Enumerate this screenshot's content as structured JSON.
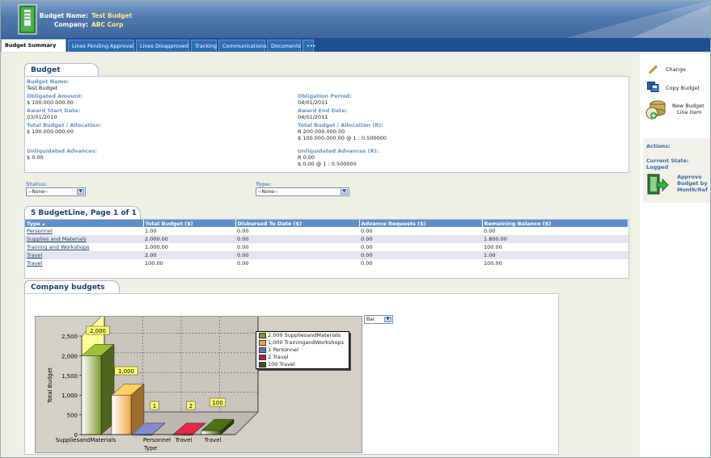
{
  "header": {
    "budget_name_label": "Budget Name:",
    "budget_name": "Test Budget",
    "company_label": "Company:",
    "company": "ABC Corp"
  },
  "tabs": [
    {
      "label": "Budget Summary"
    },
    {
      "label": "Lines Pending Approval"
    },
    {
      "label": "Lines Disapproved"
    },
    {
      "label": "Tracking"
    },
    {
      "label": "Communications"
    },
    {
      "label": "Documents"
    },
    {
      "label": "•••"
    }
  ],
  "budget": {
    "title": "Budget",
    "budget_name_label": "Budget Name:",
    "budget_name": "Test Budget",
    "obligated_label": "Obligated Amount:",
    "obligated": "$ 100.000.000.00",
    "obligation_period_label": "Obligation Period:",
    "obligation_period": "04/01/2011",
    "award_start_label": "Award Start Date:",
    "award_start": "03/01/2010",
    "award_end_label": "Award End Date:",
    "award_end": "04/01/2011",
    "total_label": "Total Budget / Allocation:",
    "total": "$ 100.000.000.00",
    "total_r_label": "Total Budget / Allocation (R):",
    "total_r_1": "R 200.000.000.00",
    "total_r_2": "$ 100.000.000.00 @ 1 : 0.500000",
    "unliq_label": "Unliquidated Advances:",
    "unliq": "$ 0.00",
    "unliq_r_label": "Unliquidated Advances (R):",
    "unliq_r_1": "R 0.00",
    "unliq_r_2": "$ 0.00 @ 1 : 0.500000"
  },
  "filters": {
    "status_label": "Status:",
    "status_value": "--None--",
    "type_label": "Type:",
    "type_value": "--None--"
  },
  "lines": {
    "title": "5 BudgetLine, Page 1 of 1",
    "headers": [
      "Type ▴",
      "Total Budget ($)",
      "Disbursed To Date ($)",
      "Advance Requests ($)",
      "Remaining Balance ($)"
    ],
    "rows": [
      [
        "Personnel",
        "1.00",
        "0.00",
        "0.00",
        "0.00"
      ],
      [
        "Supplies and Materials",
        "2.000.00",
        "0.00",
        "0.00",
        "1.800.00"
      ],
      [
        "Training and Workshops",
        "1.000.00",
        "0.00",
        "0.00",
        "100.00"
      ],
      [
        "Travel",
        "2.00",
        "0.00",
        "0.00",
        "1.00"
      ],
      [
        "Travel",
        "100.00",
        "0.00",
        "0.00",
        "100.00"
      ]
    ]
  },
  "company_budgets": {
    "title": "Company budgets",
    "chart_type_select": "Bar"
  },
  "sidebar": {
    "change": "Change",
    "copy_budget": "Copy Budget",
    "new_line_1": "New Budget",
    "new_line_2": "Line Item",
    "actions_label": "Actions:",
    "current_state": "Current State: Logged",
    "approve_1": "Approve",
    "approve_2": "Budget by",
    "approve_3": "Month/Ref"
  },
  "chart_data": {
    "type": "bar",
    "categories": [
      "SuppliesandMaterials",
      "Personnel",
      "Travel",
      "Travel"
    ],
    "extra_category": "TrainingandWorkshops",
    "series": [
      {
        "name": "2,000  SuppliesandMaterials",
        "value": 2000,
        "color": "#7c9a2e"
      },
      {
        "name": "1,000  TrainingandWorkshops",
        "value": 1000,
        "color": "#f0a64a"
      },
      {
        "name": "1  Personnel",
        "value": 1,
        "color": "#6a70a8"
      },
      {
        "name": "2  Travel",
        "value": 2,
        "color": "#b4203a"
      },
      {
        "name": "100  Travel",
        "value": 100,
        "color": "#3d5a10"
      }
    ],
    "data_labels": [
      "2,000",
      "1,000",
      "1",
      "2",
      "100"
    ],
    "xlabel": "Type",
    "ylabel": "Total Budget",
    "yticks": [
      "0",
      "500",
      "1,000",
      "1,500",
      "2,000",
      "2,500"
    ],
    "ylim": [
      0,
      2500
    ],
    "grid": true,
    "legend": "top-right"
  }
}
